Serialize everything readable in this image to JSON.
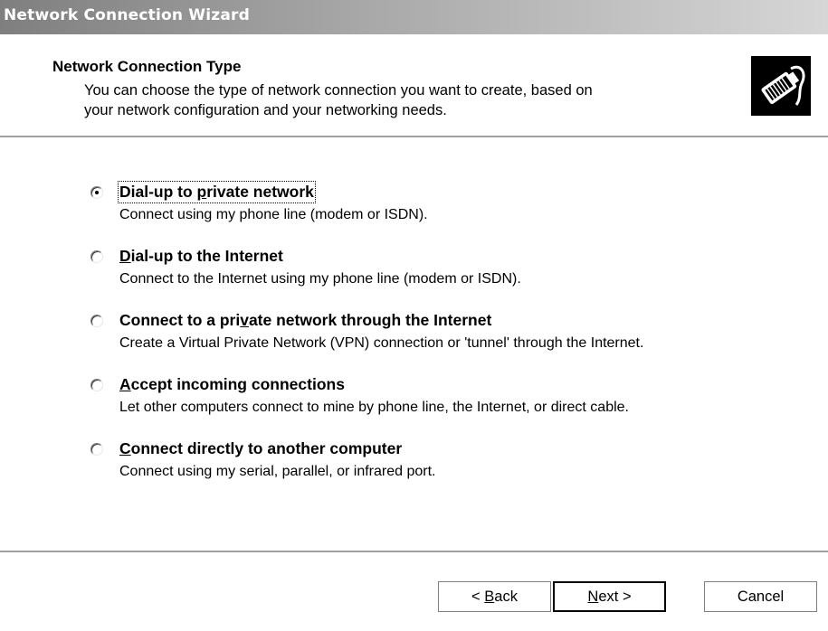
{
  "window": {
    "title": "Network Connection Wizard"
  },
  "header": {
    "title": "Network Connection Type",
    "description_line1": "You can choose the type of network connection you want to create, based on",
    "description_line2": "your network configuration and your networking needs.",
    "icon": "network-cable-plug-icon"
  },
  "options": [
    {
      "label_pre": "Dial-up to ",
      "label_key": "p",
      "label_post": "rivate network",
      "desc": "Connect using my phone line (modem or ISDN).",
      "selected": true
    },
    {
      "label_pre": "",
      "label_key": "D",
      "label_post": "ial-up to the Internet",
      "desc": "Connect to the Internet using my phone line (modem or ISDN).",
      "selected": false
    },
    {
      "label_pre": "Connect to a pri",
      "label_key": "v",
      "label_post": "ate network through the Internet",
      "desc": "Create a Virtual Private Network (VPN) connection or 'tunnel' through the Internet.",
      "selected": false
    },
    {
      "label_pre": "",
      "label_key": "A",
      "label_post": "ccept incoming connections",
      "desc": "Let other computers connect to mine by phone line, the Internet, or direct cable.",
      "selected": false
    },
    {
      "label_pre": "",
      "label_key": "C",
      "label_post": "onnect directly to another computer",
      "desc": "Connect using my serial, parallel, or infrared port.",
      "selected": false
    }
  ],
  "buttons": {
    "back_pre": "< ",
    "back_key": "B",
    "back_post": "ack",
    "next_key": "N",
    "next_post": "ext >",
    "cancel": "Cancel"
  }
}
